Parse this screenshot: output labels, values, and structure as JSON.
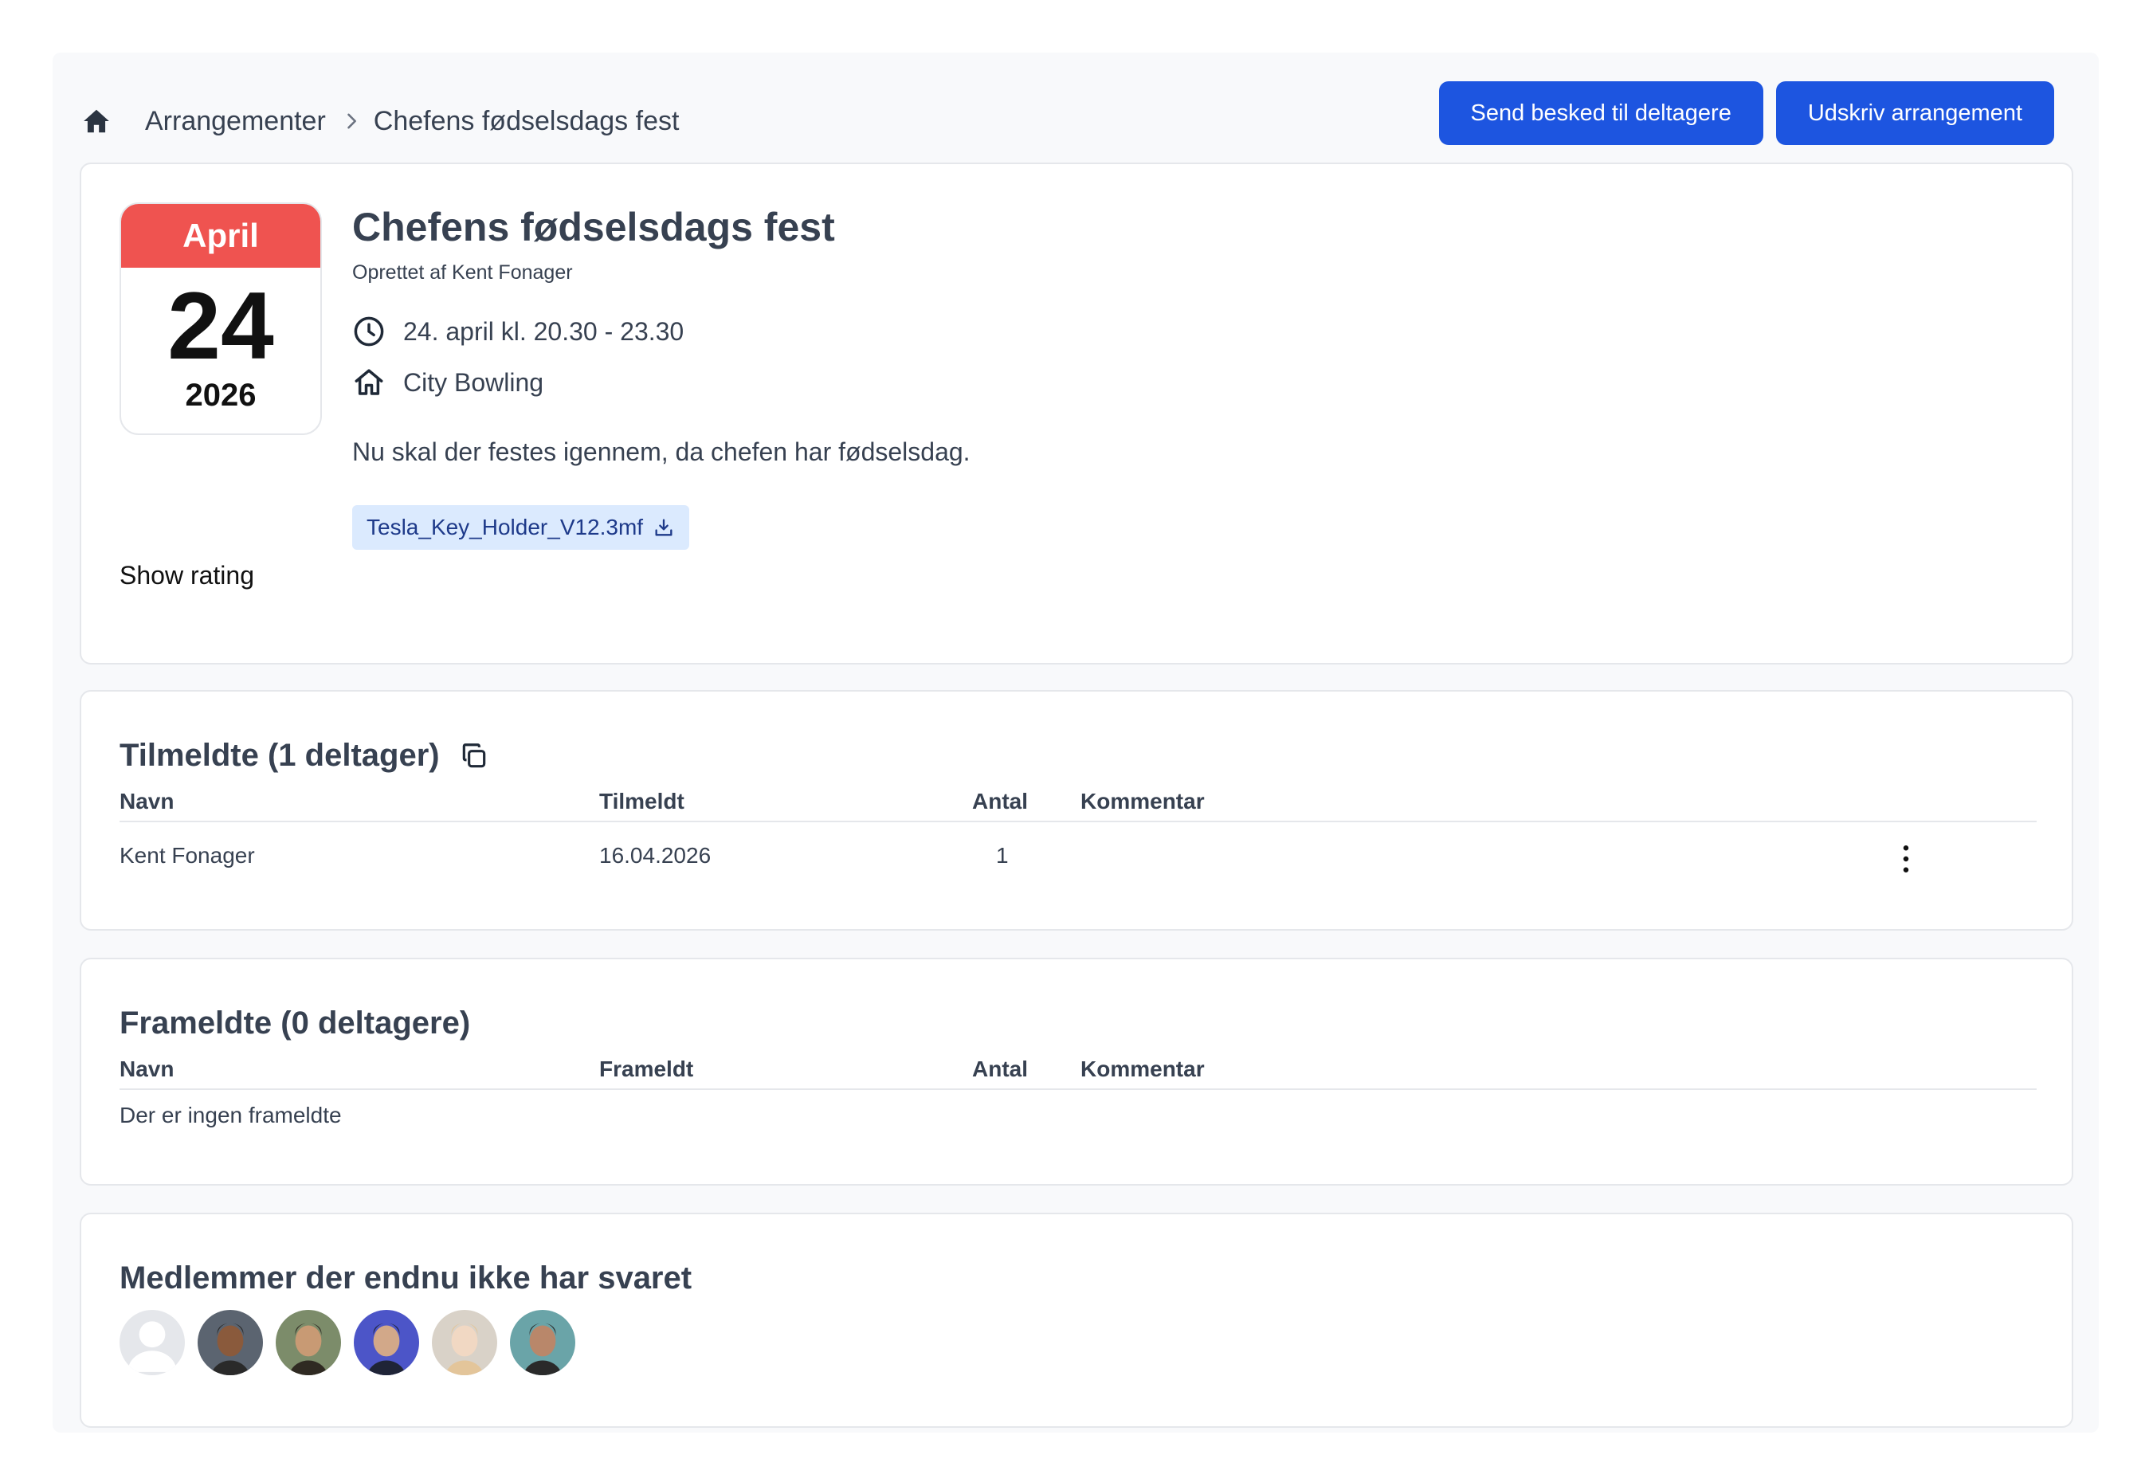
{
  "breadcrumb": {
    "root": "Arrangementer",
    "current": "Chefens fødselsdags fest"
  },
  "actions": {
    "send_message": "Send besked til deltagere",
    "print_event": "Udskriv arrangement"
  },
  "event": {
    "calendar": {
      "month": "April",
      "day": "24",
      "year": "2026"
    },
    "title": "Chefens fødselsdags fest",
    "creator": "Oprettet af Kent Fonager",
    "time": "24. april kl. 20.30 - 23.30",
    "location": "City Bowling",
    "description": "Nu skal der festes igennem, da chefen har fødselsdag.",
    "attachment": "Tesla_Key_Holder_V12.3mf",
    "show_rating": "Show rating"
  },
  "registered": {
    "title": "Tilmeldte (1 deltager)",
    "columns": [
      "Navn",
      "Tilmeldt",
      "Antal",
      "Kommentar"
    ],
    "rows": [
      {
        "name": "Kent Fonager",
        "date": "16.04.2026",
        "count": "1",
        "comment": ""
      }
    ]
  },
  "cancelled": {
    "title": "Frameldte (0 deltagere)",
    "columns": [
      "Navn",
      "Frameldt",
      "Antal",
      "Kommentar"
    ],
    "empty": "Der er ingen frameldte"
  },
  "members": {
    "title": "Medlemmer der endnu ikke har svaret",
    "avatars": [
      {
        "bg": "#e5e7eb",
        "fg": "#ffffff",
        "skin": ""
      },
      {
        "bg": "#5b6470",
        "fg": "#2a2a2a",
        "skin": "#8a5a3c"
      },
      {
        "bg": "#7c8c6a",
        "fg": "#2f2a22",
        "skin": "#c89a74"
      },
      {
        "bg": "#4c55c8",
        "fg": "#1f2437",
        "skin": "#d2a889"
      },
      {
        "bg": "#d9d2c8",
        "fg": "#e3c59a",
        "skin": "#f1d8c3"
      },
      {
        "bg": "#6aa4a8",
        "fg": "#2a2a2a",
        "skin": "#b9876a"
      }
    ]
  },
  "colors": {
    "primary": "#1d55e0",
    "calendar_header": "#ef5350",
    "attachment_bg": "#dbeafe",
    "text": "#374151"
  }
}
